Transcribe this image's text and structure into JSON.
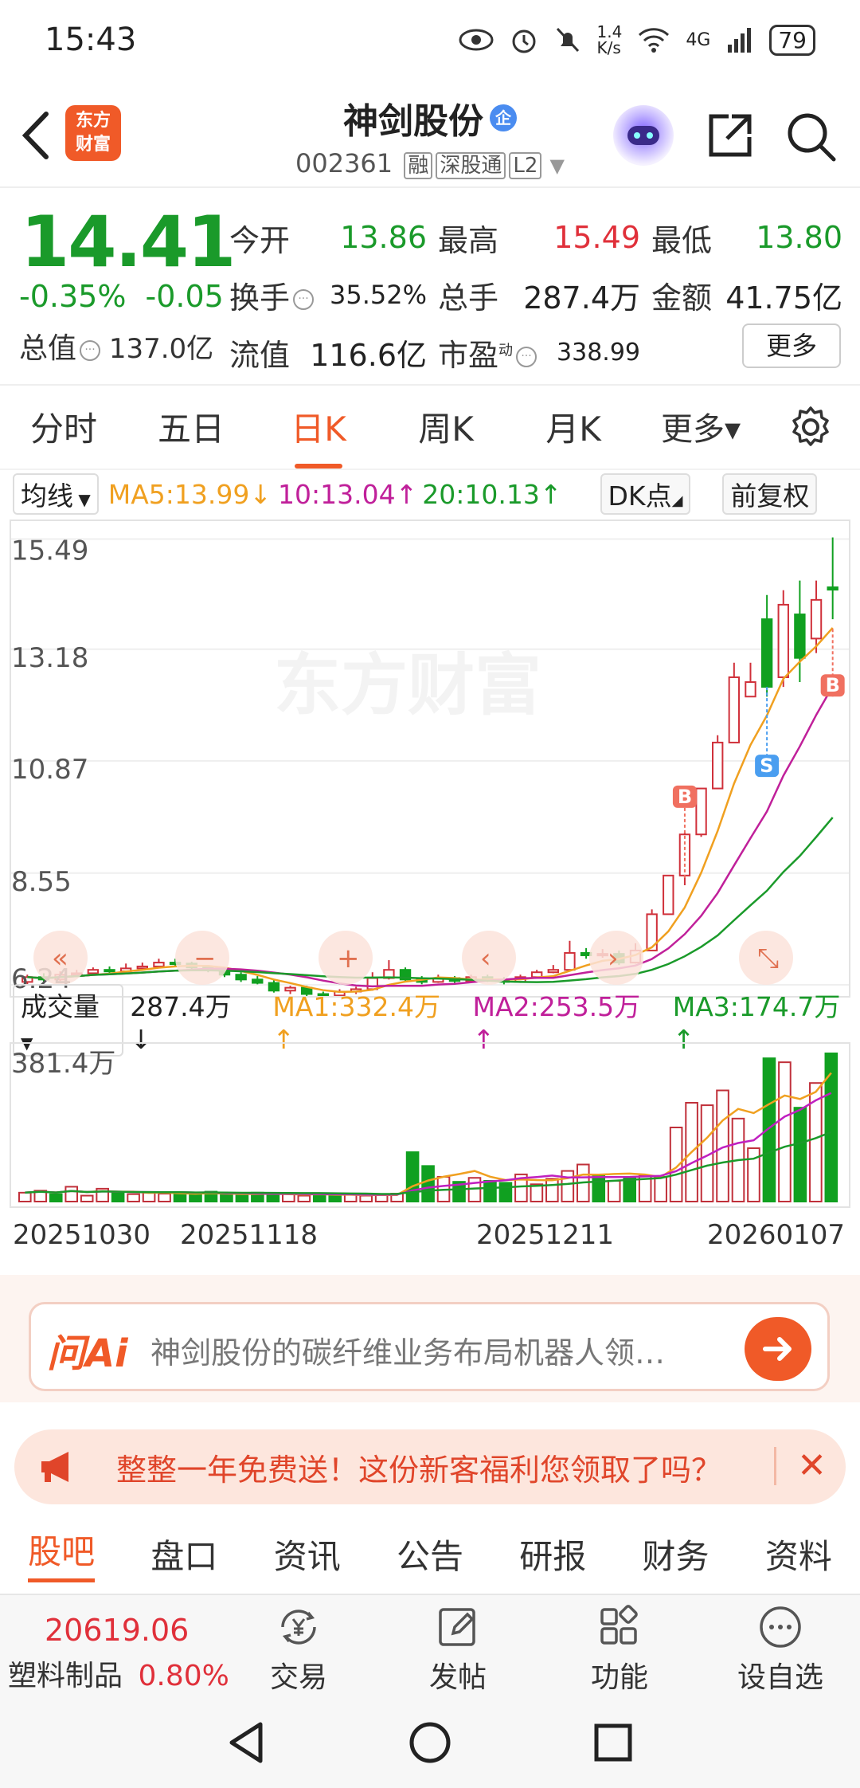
{
  "status": {
    "time": "15:43",
    "net_speed": "1.4\nK/s",
    "network": "4G",
    "battery": "79"
  },
  "header": {
    "logo_text": "东方\n财富",
    "stock_name": "神剑股份",
    "badge": "企",
    "code": "002361",
    "tags": [
      "融",
      "深股通",
      "L2"
    ]
  },
  "quote": {
    "price": "14.41",
    "change_pct": "-0.35%",
    "change_amt": "-0.05",
    "market_cap_label": "总值",
    "market_cap": "137.0亿",
    "rows": [
      [
        {
          "label": "今开",
          "value": "13.86",
          "color": "green"
        },
        {
          "label": "最高",
          "value": "15.49",
          "color": "red"
        },
        {
          "label": "最低",
          "value": "13.80",
          "color": "green"
        }
      ],
      [
        {
          "label": "换手",
          "value": "35.52%",
          "color": "none",
          "info": true
        },
        {
          "label": "总手",
          "value": "287.4万",
          "color": "none"
        },
        {
          "label": "金额",
          "value": "41.75亿",
          "color": "none"
        }
      ],
      [
        {
          "label": "流值",
          "value": "116.6亿",
          "color": "none"
        },
        {
          "label": "市盈",
          "sup": "动",
          "value": "338.99",
          "color": "none",
          "info": true
        }
      ]
    ],
    "more": "更多"
  },
  "tabs": [
    {
      "label": "分时"
    },
    {
      "label": "五日"
    },
    {
      "label": "日K",
      "active": true
    },
    {
      "label": "周K"
    },
    {
      "label": "月K"
    },
    {
      "label": "更多▾"
    }
  ],
  "ma": {
    "selector": "均线",
    "ma5": "MA5:13.99↓",
    "ma10": "10:13.04↑",
    "ma20": "20:10.13↑",
    "dk": "DK点",
    "adjust": "前复权",
    "colors": {
      "ma5": "#f0a020",
      "ma10": "#c0209a",
      "ma20": "#1a9a2a"
    }
  },
  "chart_data": {
    "type": "candlestick",
    "y_ticks": [
      "15.49",
      "13.18",
      "10.87",
      "8.55",
      "6.24"
    ],
    "ylim": [
      6.24,
      15.49
    ],
    "watermark": "东方财富",
    "candles": [
      [
        6.3,
        6.4,
        6.45,
        6.25
      ],
      [
        6.4,
        6.35,
        6.48,
        6.3
      ],
      [
        6.35,
        6.45,
        6.52,
        6.32
      ],
      [
        6.45,
        6.48,
        6.55,
        6.4
      ],
      [
        6.48,
        6.55,
        6.6,
        6.45
      ],
      [
        6.55,
        6.52,
        6.62,
        6.48
      ],
      [
        6.52,
        6.58,
        6.68,
        6.5
      ],
      [
        6.58,
        6.62,
        6.7,
        6.55
      ],
      [
        6.62,
        6.7,
        6.78,
        6.58
      ],
      [
        6.7,
        6.68,
        6.78,
        6.62
      ],
      [
        6.68,
        6.6,
        6.72,
        6.55
      ],
      [
        6.6,
        6.55,
        6.65,
        6.5
      ],
      [
        6.55,
        6.45,
        6.6,
        6.4
      ],
      [
        6.45,
        6.35,
        6.5,
        6.3
      ],
      [
        6.35,
        6.28,
        6.42,
        6.25
      ],
      [
        6.28,
        6.12,
        6.35,
        6.08
      ],
      [
        6.12,
        6.18,
        6.22,
        6.05
      ],
      [
        6.18,
        6.05,
        6.22,
        6.0
      ],
      [
        6.05,
        6.02,
        6.1,
        5.98
      ],
      [
        6.02,
        6.1,
        6.15,
        5.98
      ],
      [
        6.1,
        6.15,
        6.2,
        6.05
      ],
      [
        6.15,
        6.38,
        6.5,
        6.12
      ],
      [
        6.38,
        6.55,
        6.75,
        6.35
      ],
      [
        6.55,
        6.35,
        6.6,
        6.3
      ],
      [
        6.35,
        6.3,
        6.42,
        6.25
      ],
      [
        6.3,
        6.38,
        6.45,
        6.28
      ],
      [
        6.38,
        6.32,
        6.42,
        6.28
      ],
      [
        6.32,
        6.4,
        6.45,
        6.3
      ],
      [
        6.4,
        6.35,
        6.45,
        6.3
      ],
      [
        6.35,
        6.3,
        6.4,
        6.25
      ],
      [
        6.3,
        6.4,
        6.45,
        6.28
      ],
      [
        6.4,
        6.5,
        6.55,
        6.38
      ],
      [
        6.5,
        6.55,
        6.65,
        6.48
      ],
      [
        6.55,
        6.9,
        7.15,
        6.52
      ],
      [
        6.9,
        6.85,
        7.0,
        6.78
      ],
      [
        6.85,
        6.88,
        6.98,
        6.8
      ],
      [
        6.88,
        6.7,
        6.95,
        6.65
      ],
      [
        6.7,
        6.95,
        7.1,
        6.68
      ],
      [
        6.95,
        7.7,
        7.8,
        6.95
      ],
      [
        7.7,
        8.5,
        8.5,
        7.7
      ],
      [
        8.5,
        9.35,
        9.4,
        8.3
      ],
      [
        9.35,
        10.3,
        10.3,
        9.3
      ],
      [
        10.3,
        11.25,
        11.4,
        10.3
      ],
      [
        11.25,
        12.6,
        12.9,
        11.25
      ],
      [
        12.2,
        12.5,
        12.9,
        12.2
      ],
      [
        13.8,
        12.4,
        14.3,
        12.2
      ],
      [
        12.6,
        14.1,
        14.4,
        12.4
      ],
      [
        13.9,
        13.0,
        14.6,
        12.5
      ],
      [
        13.4,
        14.2,
        14.6,
        13.1
      ],
      [
        14.46,
        14.41,
        15.49,
        13.8
      ]
    ],
    "markers": [
      {
        "label": "B",
        "color": "#f07060"
      },
      {
        "label": "S",
        "color": "#4a9ef0"
      },
      {
        "label": "B",
        "color": "#f07060"
      }
    ]
  },
  "volume": {
    "label": "成交量",
    "value": "287.4万↓",
    "ma1": "MA1:332.4万↑",
    "ma2": "MA2:253.5万↑",
    "ma3": "MA3:174.7万↑",
    "max_tick": "381.4万",
    "bars": [
      18,
      22,
      15,
      30,
      12,
      26,
      17,
      15,
      18,
      16,
      18,
      13,
      20,
      14,
      12,
      18,
      14,
      16,
      12,
      15,
      12,
      14,
      12,
      13,
      16,
      100,
      72,
      50,
      40,
      48,
      42,
      38,
      55,
      35,
      46,
      62,
      75,
      54,
      42,
      50,
      52,
      50,
      150,
      200,
      195,
      225,
      168,
      108,
      290,
      282,
      190,
      240,
      300
    ],
    "dates": [
      "20251030",
      "20251118",
      "20251211",
      "20260107"
    ]
  },
  "ai": {
    "logo": "问Ai",
    "text": "神剑股份的碳纤维业务布局机器人领…"
  },
  "promo": {
    "text": "整整一年免费送！这份新客福利您领取了吗？"
  },
  "subtabs": [
    {
      "label": "股吧",
      "active": true
    },
    {
      "label": "盘口"
    },
    {
      "label": "资讯"
    },
    {
      "label": "公告"
    },
    {
      "label": "研报"
    },
    {
      "label": "财务"
    },
    {
      "label": "资料"
    }
  ],
  "bottom": {
    "index_value": "20619.06",
    "index_name": "塑料制品",
    "index_pct": "0.80%",
    "nav": [
      "交易",
      "发帖",
      "功能",
      "设自选"
    ]
  }
}
